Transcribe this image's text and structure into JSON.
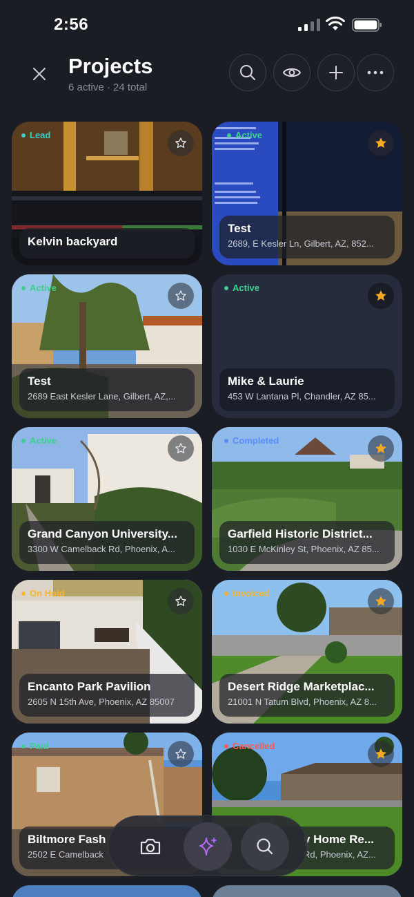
{
  "status": {
    "time": "2:56"
  },
  "header": {
    "title": "Projects",
    "subtitle": "6 active · 24 total"
  },
  "colors": {
    "lead": "#33d1c8",
    "active": "#3ecf8e",
    "completed": "#5b8cff",
    "onhold": "#f5b431",
    "invoiced": "#f5b431",
    "cancelled": "#ff5a55",
    "star_filled": "#f7a824",
    "sparkle": "#b36bff"
  },
  "projects": [
    {
      "status": "Lead",
      "name": "Kelvin backyard",
      "address": "",
      "starred": false
    },
    {
      "status": "Active",
      "name": "Test",
      "address": "2689, E Kesler Ln, Gilbert, AZ, 852...",
      "starred": true
    },
    {
      "status": "Active",
      "name": "Test",
      "address": "2689 East Kesler Lane, Gilbert, AZ,...",
      "starred": false
    },
    {
      "status": "Active",
      "name": "Mike & Laurie",
      "address": "453 W Lantana Pl, Chandler, AZ 85...",
      "starred": true
    },
    {
      "status": "Active",
      "name": "Grand Canyon University...",
      "address": "3300 W Camelback Rd, Phoenix, A...",
      "starred": false
    },
    {
      "status": "Completed",
      "name": "Garfield Historic District...",
      "address": "1030 E McKinley St, Phoenix, AZ 85...",
      "starred": true
    },
    {
      "status": "On Hold",
      "name": "Encanto Park Pavilion",
      "address": "2605 N 15th Ave, Phoenix, AZ 85007",
      "starred": false
    },
    {
      "status": "Invoiced",
      "name": "Desert Ridge Marketplac...",
      "address": "21001 N Tatum Blvd, Phoenix, AZ 8...",
      "starred": true
    },
    {
      "status": "Paid",
      "name": "Biltmore Fash",
      "address": "2502 E Camelback",
      "starred": false
    },
    {
      "status": "Cancelled",
      "name": "y Home Re...",
      "address": "Rd, Phoenix, AZ...",
      "starred": true
    }
  ],
  "dock": {
    "items": [
      {
        "icon": "camera-icon"
      },
      {
        "icon": "sparkle-icon"
      },
      {
        "icon": "search-icon"
      }
    ]
  }
}
